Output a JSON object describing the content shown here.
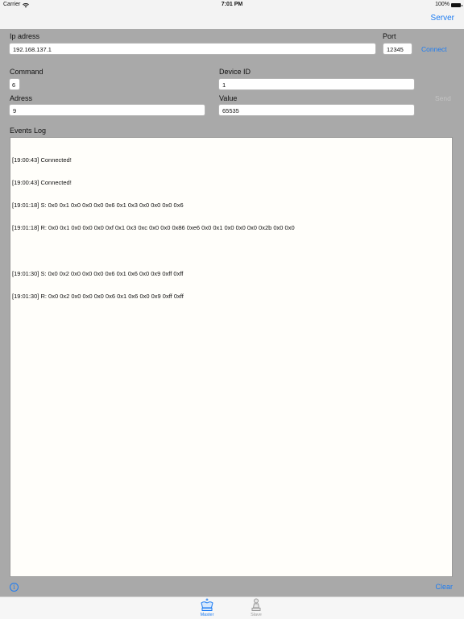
{
  "status_bar": {
    "carrier": "Carrier",
    "time": "7:01 PM",
    "battery": "100%"
  },
  "nav": {
    "server_label": "Server"
  },
  "connection": {
    "ip_label": "Ip adress",
    "ip_value": "192.168.137.1",
    "port_label": "Port",
    "port_value": "12345",
    "connect_label": "Connect"
  },
  "command": {
    "command_label": "Command",
    "command_value": "6",
    "device_id_label": "Device ID",
    "device_id_value": "1",
    "address_label": "Adress",
    "address_value": "9",
    "value_label": "Value",
    "value_value": "65535",
    "send_label": "Send"
  },
  "events": {
    "title": "Events Log",
    "lines": [
      "[19:00:43] Connected!",
      "[19:00:43] Connected!",
      "[19:01:18] S: 0x0 0x1 0x0 0x0 0x0 0x6 0x1 0x3 0x0 0x0 0x0 0x6",
      "[19:01:18] R: 0x0 0x1 0x0 0x0 0x0 0xf 0x1 0x3 0xc 0x0 0x0 0x86 0xe6 0x0 0x1 0x0 0x0 0x0 0x2b 0x0 0x0",
      "",
      "[19:01:30] S: 0x0 0x2 0x0 0x0 0x0 0x6 0x1 0x6 0x0 0x9 0xff 0xff",
      "[19:01:30] R: 0x0 0x2 0x0 0x0 0x0 0x6 0x1 0x6 0x0 0x9 0xff 0xff"
    ]
  },
  "bottom": {
    "info_icon": "i",
    "clear_label": "Clear"
  },
  "tabs": [
    {
      "label": "Master",
      "icon": "king-icon",
      "active": true
    },
    {
      "label": "Slave",
      "icon": "pawn-icon",
      "active": false
    }
  ],
  "colors": {
    "accent": "#1d7cf2",
    "background": "#a9a9a9",
    "log_background": "#fffefa"
  }
}
